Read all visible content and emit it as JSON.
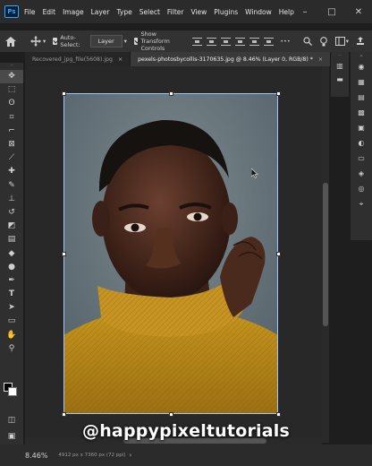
{
  "menubar": {
    "logo": "Ps",
    "items": [
      "File",
      "Edit",
      "Image",
      "Layer",
      "Type",
      "Select",
      "Filter",
      "View",
      "Plugins",
      "Window",
      "Help"
    ],
    "window_controls": [
      "–",
      "□",
      "✕"
    ]
  },
  "options": {
    "auto_select_label": "Auto-Select:",
    "auto_select_target": "Layer",
    "show_transform_label": "Show Transform Controls"
  },
  "tabs": [
    {
      "label": "Recovered_jpg_file(5608).jpg",
      "close": "×"
    },
    {
      "label": "pexels-photosbycollis-3170635.jpg @ 8.46% (Layer 0, RGB/8) *",
      "close": "×"
    }
  ],
  "tabs_overflow": "»",
  "toolbar": {
    "tools": [
      "move-tool",
      "marquee-tool",
      "lasso-tool",
      "object-select-tool",
      "crop-tool",
      "frame-tool",
      "eyedropper-tool",
      "healing-tool",
      "brush-tool",
      "clone-stamp-tool",
      "history-brush-tool",
      "eraser-tool",
      "gradient-tool",
      "blur-tool",
      "dodge-tool",
      "pen-tool",
      "type-tool",
      "path-select-tool",
      "rectangle-tool",
      "hand-tool",
      "zoom-tool"
    ]
  },
  "status": {
    "zoom": "8.46%",
    "doc_info": "4912 px x 7360 px (72 ppi)"
  },
  "watermark": "@happypixeltutorials",
  "colors": {
    "accent": "#31a8ff",
    "sweater": "#b8891c",
    "background_wall": "#6e7c80"
  }
}
